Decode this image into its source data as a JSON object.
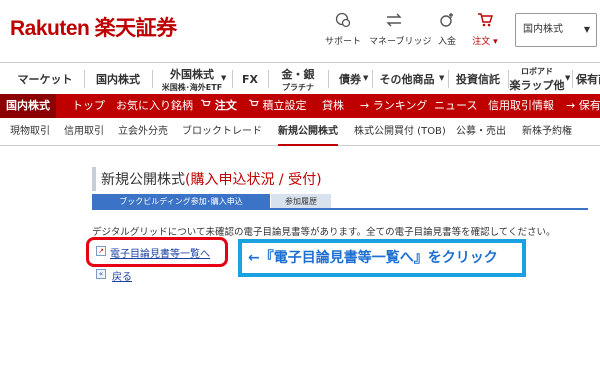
{
  "header": {
    "logo_text": "Rakuten 楽天証券",
    "icons": [
      {
        "icon": "support-chat-icon",
        "label": "サポート"
      },
      {
        "icon": "money-bridge-icon",
        "label": "マネーブリッジ"
      },
      {
        "icon": "deposit-icon",
        "label": "入金"
      },
      {
        "icon": "cart-icon",
        "label": "注文 ▾"
      }
    ],
    "market_select": "国内株式"
  },
  "nav1": {
    "items": [
      {
        "label": "マーケット",
        "sub": ""
      },
      {
        "label": "国内株式",
        "sub": ""
      },
      {
        "label": "外国株式",
        "sub": "米国株･海外ETF"
      },
      {
        "label": "FX",
        "sub": ""
      },
      {
        "label": "金・銀",
        "sub": "プラチナ"
      },
      {
        "label": "債券",
        "sub": ""
      },
      {
        "label": "その他商品",
        "sub": ""
      },
      {
        "label": "投資信託",
        "sub": ""
      },
      {
        "label": "ロボアド",
        "sub": "楽ラップ他"
      },
      {
        "label": "保有商",
        "sub": ""
      }
    ]
  },
  "nav2": {
    "section": "国内株式",
    "items": [
      "トップ",
      "お気に入り銘柄",
      "注文",
      "積立設定",
      "貸株",
      "ランキング",
      "ニュース",
      "信用取引情報",
      "保有銘"
    ]
  },
  "nav3": {
    "items": [
      "現物取引",
      "信用取引",
      "立会外分売",
      "ブロックトレード",
      "新規公開株式",
      "株式公開買付 (TOB)",
      "公募・売出",
      "新株予約権"
    ]
  },
  "page": {
    "title": "新規公開株式",
    "title_sub": "(購入申込状況 / 受付)",
    "tabs": [
      "ブックビルディング参加･購入申込",
      "参加履歴"
    ],
    "notice": "デジタルグリッドについて未確認の電子目論見書等があります。全ての電子目論見書等を確認してください。",
    "doc_link": "電子目論見書等一覧へ",
    "back_link": "戻る"
  },
  "annotation": {
    "text": "←『電子目論見書等一覧へ』をクリック"
  },
  "colors": {
    "brand_red": "#bf0000",
    "tab_blue": "#3b74c7",
    "highlight_red": "#e60012",
    "annotation_blue": "#1ba0e2"
  }
}
